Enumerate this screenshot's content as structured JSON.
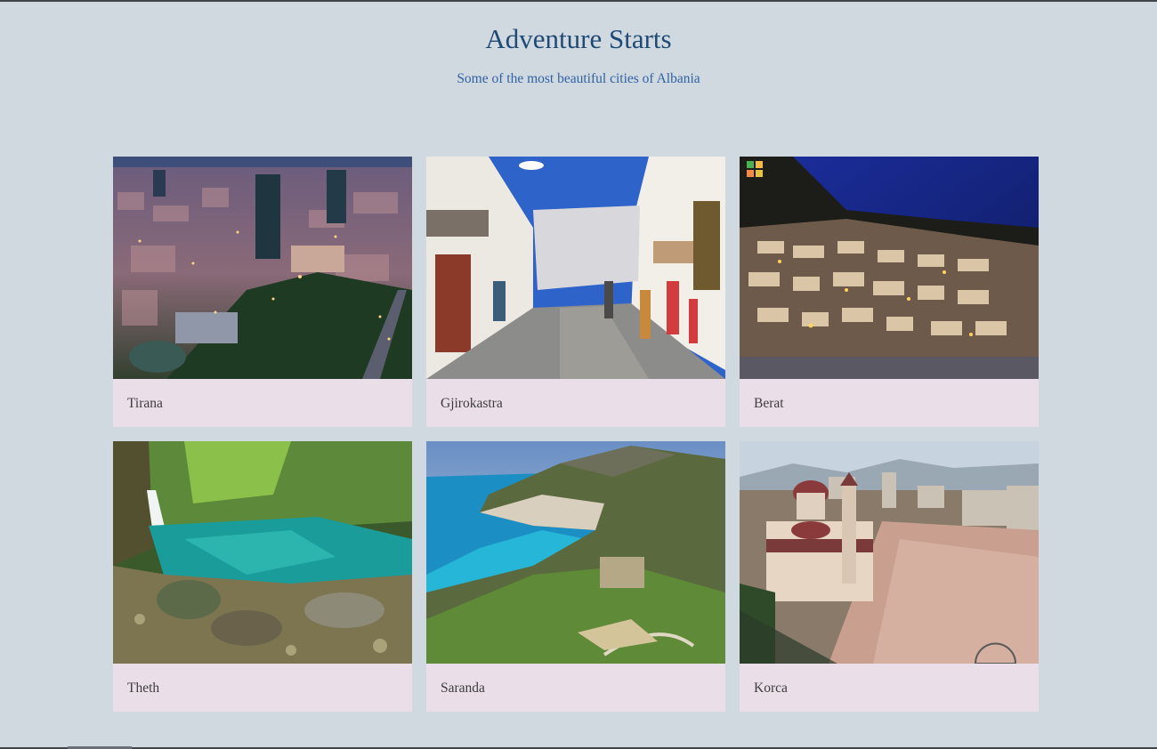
{
  "header": {
    "title": "Adventure Starts",
    "subtitle": "Some of the most beautiful cities of Albania"
  },
  "cards": [
    {
      "label": "Tirana",
      "photo": "city-night-aerial"
    },
    {
      "label": "Gjirokastra",
      "photo": "old-town-street"
    },
    {
      "label": "Berat",
      "photo": "hillside-houses-night"
    },
    {
      "label": "Theth",
      "photo": "waterfall-pool"
    },
    {
      "label": "Saranda",
      "photo": "coastal-bay"
    },
    {
      "label": "Korca",
      "photo": "cathedral-square"
    }
  ]
}
